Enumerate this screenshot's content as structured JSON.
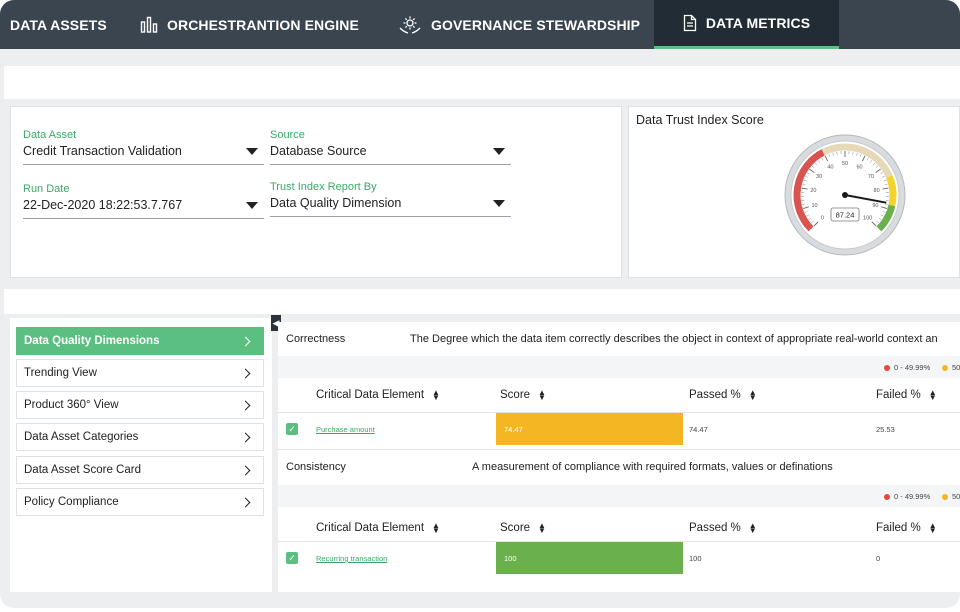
{
  "nav": {
    "tabs": [
      {
        "label": "DATA ASSETS"
      },
      {
        "label": "ORCHESTRANTION ENGINE"
      },
      {
        "label": "GOVERNANCE STEWARDSHIP"
      },
      {
        "label": "DATA METRICS"
      }
    ],
    "active_tab": "DATA METRICS"
  },
  "filters": {
    "data_asset": {
      "label": "Data Asset",
      "value": "Credit Transaction Validation"
    },
    "source": {
      "label": "Source",
      "value": "Database Source"
    },
    "run_date": {
      "label": "Run Date",
      "value": "22-Dec-2020 18:22:53.7.767"
    },
    "report_by": {
      "label": "Trust Index Report By",
      "value": "Data Quality Dimension"
    }
  },
  "gauge": {
    "title": "Data Trust Index Score",
    "value": "87.24",
    "value_num": 87.24,
    "ticks": [
      "0",
      "10",
      "20",
      "30",
      "40",
      "50",
      "60",
      "70",
      "80",
      "90",
      "100"
    ]
  },
  "menu": {
    "items": [
      {
        "label": "Data Quality Dimensions",
        "active": true
      },
      {
        "label": "Trending View"
      },
      {
        "label": "Product 360° View"
      },
      {
        "label": "Data Asset Categories"
      },
      {
        "label": "Data Asset Score Card"
      },
      {
        "label": "Policy Compliance"
      }
    ]
  },
  "legend": [
    {
      "label": "0 - 49.99%",
      "color": "#e8483a"
    },
    {
      "label": "50",
      "color": "#f5b623"
    }
  ],
  "columns": {
    "element": "Critical Data Element",
    "score": "Score",
    "passed": "Passed %",
    "failed": "Failed %"
  },
  "sections": [
    {
      "name": "Correctness",
      "description": "The Degree which the data item correctly describes the object in context of appropriate real-world context an",
      "rows": [
        {
          "element": "Purchase amount",
          "score": "74.47",
          "score_color": "#f5b623",
          "passed": "74.47",
          "failed": "25.53"
        }
      ]
    },
    {
      "name": "Consistency",
      "description": "A measurement of compliance with required formats, values or definations",
      "rows": [
        {
          "element": "Recurring transaction",
          "score": "100",
          "score_color": "#6ab04c",
          "passed": "100",
          "failed": "0"
        }
      ]
    }
  ],
  "colors": {
    "accent": "#5bbf82",
    "nav_bg": "#3b4550",
    "nav_active_bg": "#222c35"
  }
}
